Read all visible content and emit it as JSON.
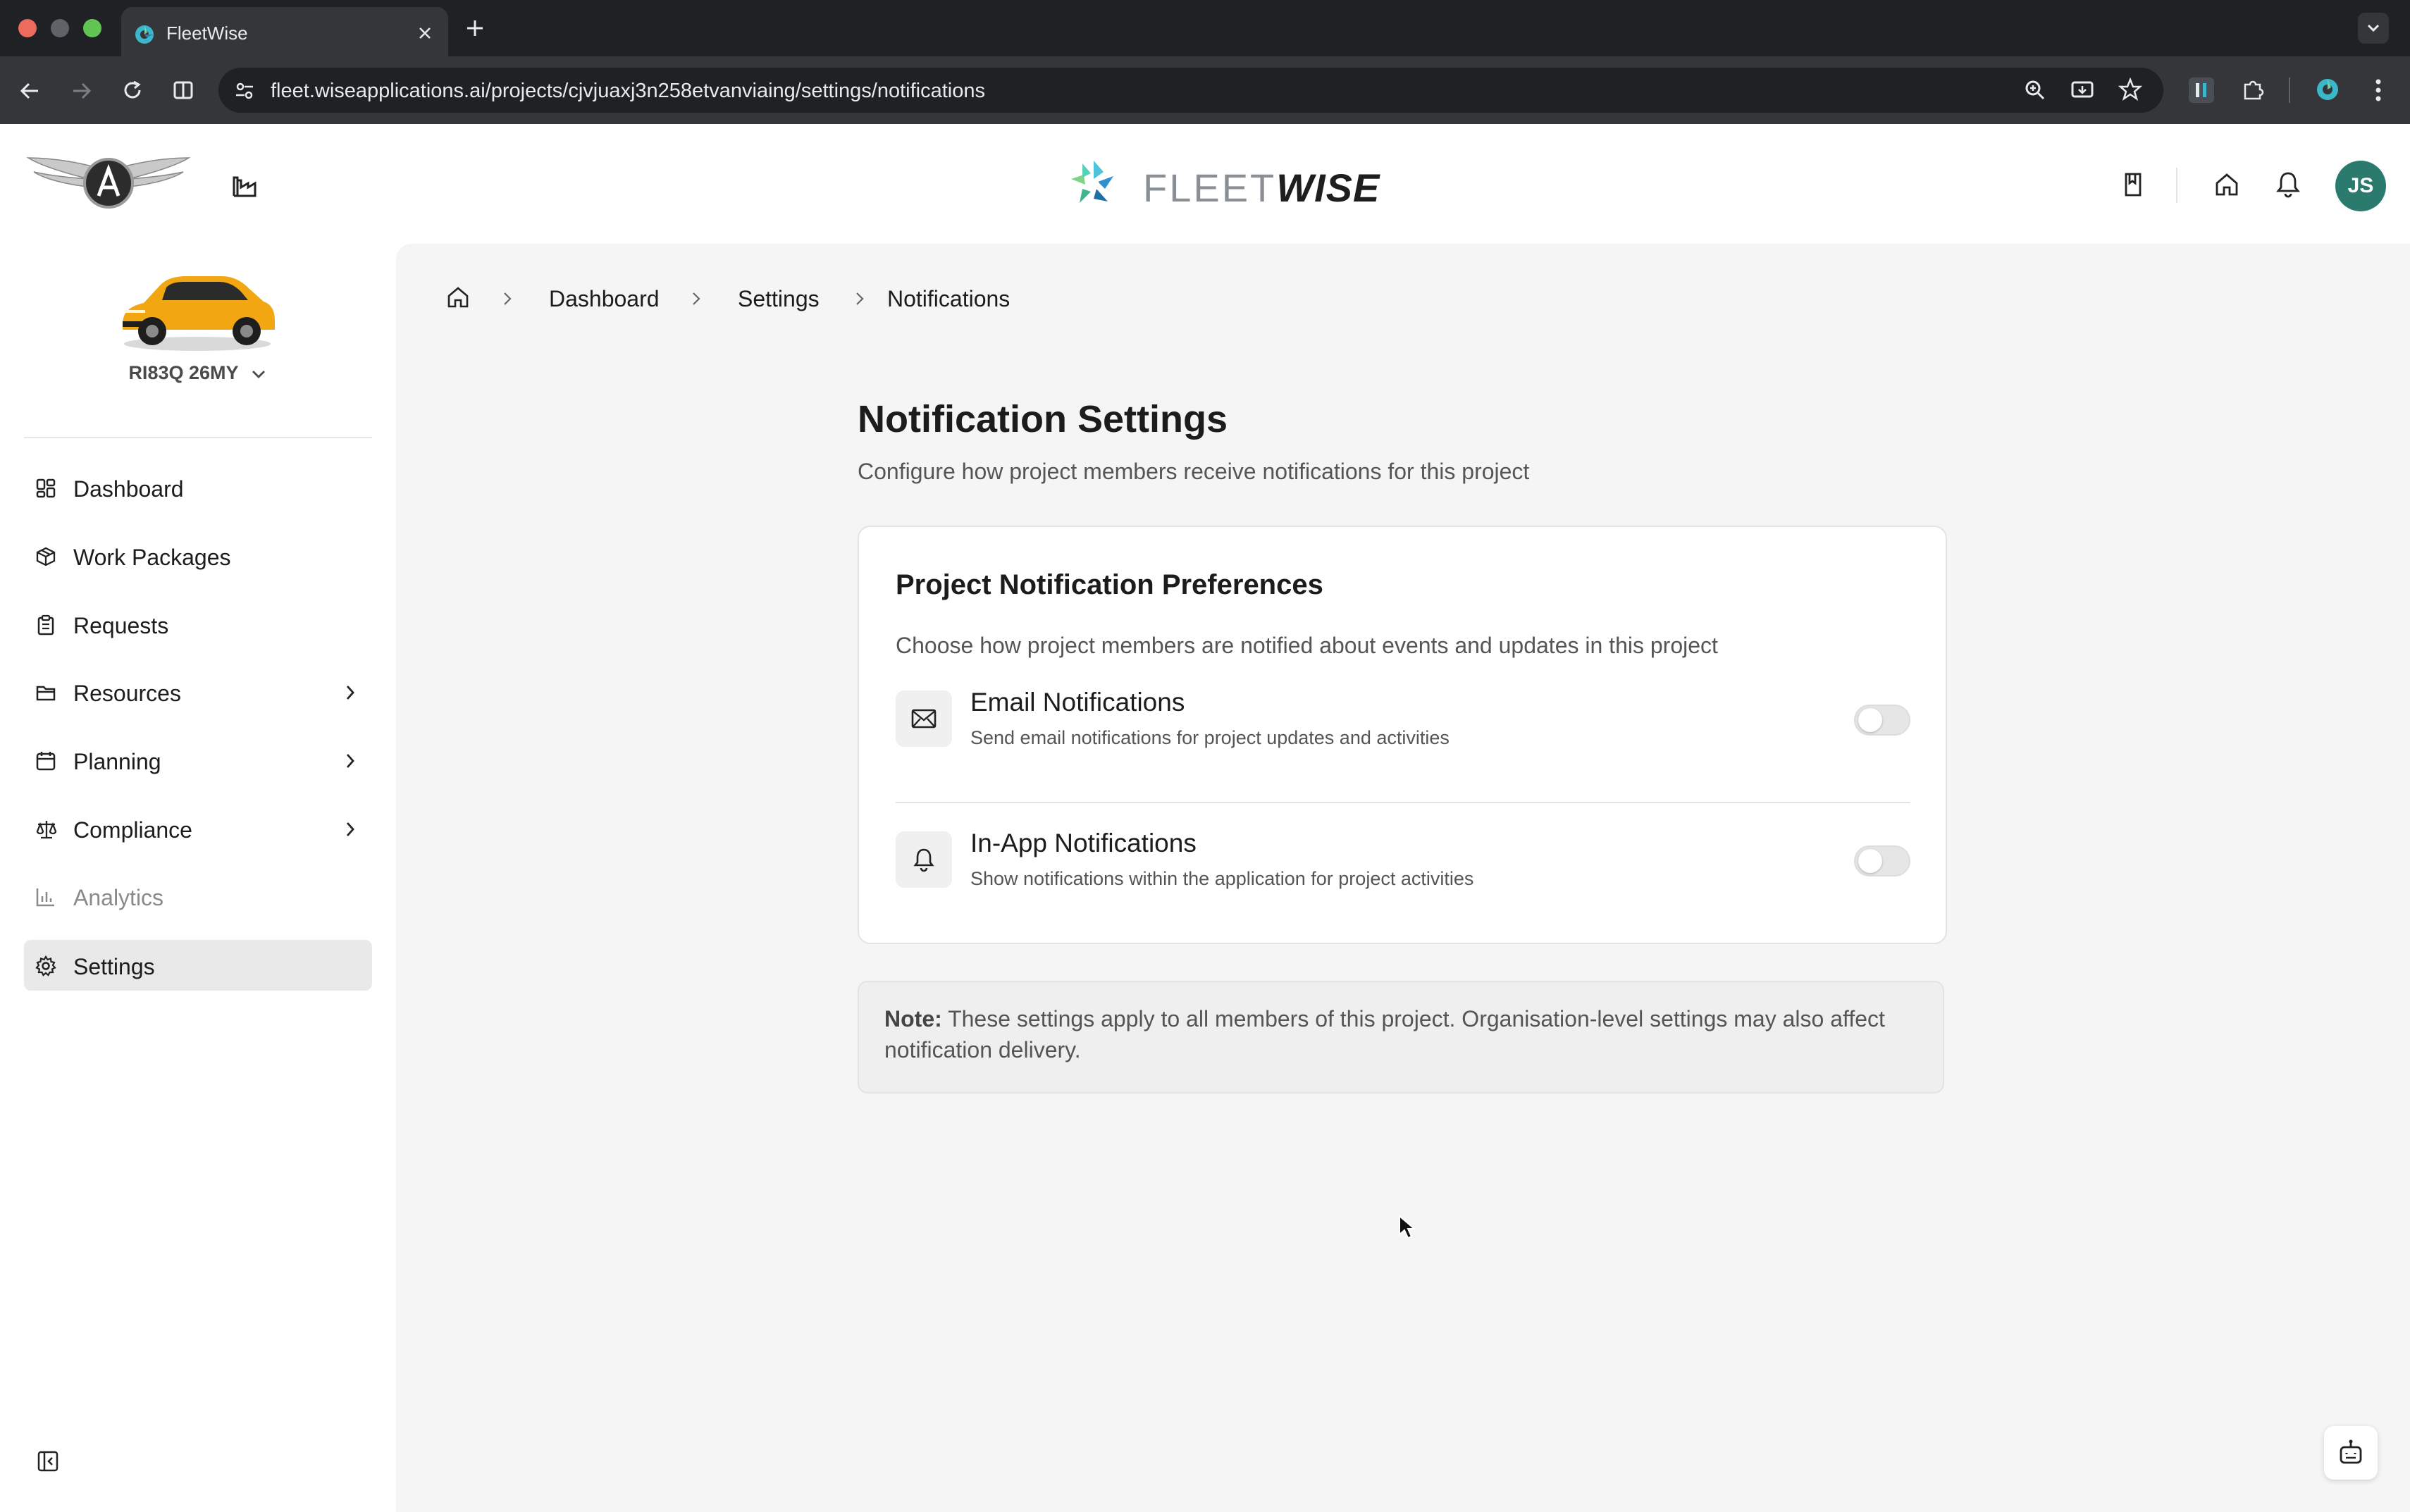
{
  "browser": {
    "tab_title": "FleetWise",
    "url": "fleet.wiseapplications.ai/projects/cjvjuaxj3n258etvanviaing/settings/notifications",
    "traffic_colors": [
      "#ed6a5e",
      "#5f6368",
      "#61c554"
    ]
  },
  "header": {
    "brand_light": "FLEET",
    "brand_bold": "WISE",
    "avatar_initials": "JS"
  },
  "sidebar": {
    "vehicle_name": "RI83Q 26MY",
    "items": [
      {
        "label": "Dashboard",
        "icon": "dashboard-icon",
        "state": "normal"
      },
      {
        "label": "Work Packages",
        "icon": "package-icon",
        "state": "normal"
      },
      {
        "label": "Requests",
        "icon": "clipboard-icon",
        "state": "normal"
      },
      {
        "label": "Resources",
        "icon": "folder-icon",
        "state": "normal",
        "has_children": true
      },
      {
        "label": "Planning",
        "icon": "calendar-icon",
        "state": "normal",
        "has_children": true
      },
      {
        "label": "Compliance",
        "icon": "scales-icon",
        "state": "normal",
        "has_children": true
      },
      {
        "label": "Analytics",
        "icon": "bar-chart-icon",
        "state": "disabled"
      },
      {
        "label": "Settings",
        "icon": "gear-icon",
        "state": "active"
      }
    ]
  },
  "breadcrumb": {
    "items": [
      "Dashboard",
      "Settings",
      "Notifications"
    ]
  },
  "page": {
    "title": "Notification Settings",
    "subtitle": "Configure how project members receive notifications for this project"
  },
  "card": {
    "title": "Project Notification Preferences",
    "description": "Choose how project members are notified about events and updates in this project",
    "preferences": [
      {
        "title": "Email Notifications",
        "description": "Send email notifications for project updates and activities",
        "enabled": false,
        "icon": "mail-icon"
      },
      {
        "title": "In-App Notifications",
        "description": "Show notifications within the application for project activities",
        "enabled": false,
        "icon": "bell-icon"
      }
    ]
  },
  "note": {
    "label": "Note:",
    "text": " These settings apply to all members of this project. Organisation-level settings may also affect notification delivery."
  },
  "colors": {
    "accent_teal": "#2a7a6d",
    "active_nav_bg": "#e9e9e9",
    "main_bg": "#f5f5f5"
  }
}
